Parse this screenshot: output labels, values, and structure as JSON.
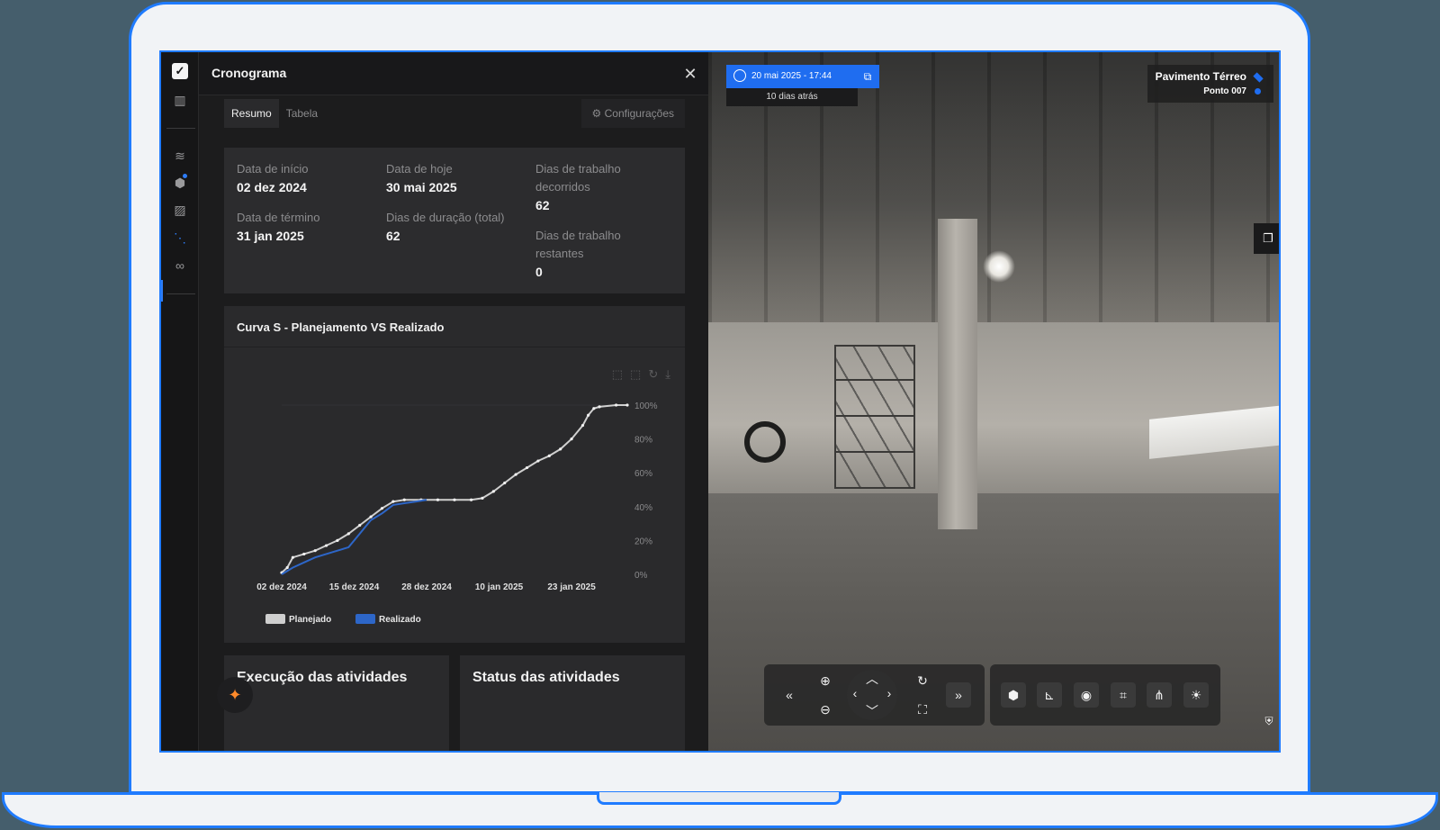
{
  "panel": {
    "title": "Cronograma",
    "close_icon": "close-icon",
    "tabs": [
      {
        "label": "Resumo",
        "active": true
      },
      {
        "label": "Tabela",
        "active": false
      }
    ],
    "config_label": "Configurações"
  },
  "summary": {
    "start_label": "Data de início",
    "start_value": "02 dez 2024",
    "today_label": "Data de hoje",
    "today_value": "30 mai 2025",
    "elapsed_label_1": "Dias de trabalho",
    "elapsed_label_2": "decorridos",
    "elapsed_value": "62",
    "end_label": "Data de término",
    "end_value": "31 jan 2025",
    "duration_label": "Dias de duração (total)",
    "duration_value": "62",
    "remaining_label_1": "Dias de trabalho",
    "remaining_label_2": "restantes",
    "remaining_value": "0"
  },
  "chart_card": {
    "title": "Curva S - Planejamento VS Realizado"
  },
  "chart_data": {
    "type": "line",
    "xlabel": "",
    "ylabel": "",
    "x_ticks": [
      "02 dez 2024",
      "15 dez 2024",
      "28 dez 2024",
      "10 jan 2025",
      "23 jan 2025"
    ],
    "y_ticks": [
      "0%",
      "20%",
      "40%",
      "60%",
      "80%",
      "100%"
    ],
    "ylim": [
      0,
      100
    ],
    "xlim": [
      0,
      62
    ],
    "series": [
      {
        "name": "Planejado",
        "color": "#cfcfcf",
        "points": [
          [
            0,
            1
          ],
          [
            1,
            4
          ],
          [
            2,
            10
          ],
          [
            4,
            12
          ],
          [
            6,
            14
          ],
          [
            8,
            17
          ],
          [
            10,
            20
          ],
          [
            12,
            24
          ],
          [
            14,
            29
          ],
          [
            16,
            34
          ],
          [
            18,
            39
          ],
          [
            20,
            43
          ],
          [
            22,
            44
          ],
          [
            25,
            44
          ],
          [
            28,
            44
          ],
          [
            31,
            44
          ],
          [
            34,
            44
          ],
          [
            36,
            45
          ],
          [
            38,
            49
          ],
          [
            40,
            54
          ],
          [
            42,
            59
          ],
          [
            44,
            63
          ],
          [
            46,
            67
          ],
          [
            48,
            70
          ],
          [
            50,
            74
          ],
          [
            52,
            80
          ],
          [
            54,
            88
          ],
          [
            55,
            94
          ],
          [
            56,
            98
          ],
          [
            57,
            99
          ],
          [
            60,
            100
          ],
          [
            62,
            100
          ]
        ]
      },
      {
        "name": "Realizado",
        "color": "#2d66c8",
        "points": [
          [
            0,
            0
          ],
          [
            2,
            4
          ],
          [
            4,
            7
          ],
          [
            6,
            10
          ],
          [
            8,
            12
          ],
          [
            10,
            14
          ],
          [
            12,
            16
          ],
          [
            14,
            24
          ],
          [
            16,
            32
          ],
          [
            18,
            36
          ],
          [
            20,
            41
          ],
          [
            22,
            42
          ],
          [
            24,
            43
          ],
          [
            26,
            44
          ]
        ]
      }
    ]
  },
  "bottom_cards": [
    {
      "title": "Execução das atividades"
    },
    {
      "title": "Status das atividades"
    }
  ],
  "viewer": {
    "date_label": "20 mai 2025 - 17:44",
    "date_sub": "10 dias atrás",
    "floor": "Pavimento Térreo",
    "point": "Ponto 007"
  },
  "icons": {
    "rail": [
      "app-logo-icon",
      "building-icon",
      "layers-icon",
      "tag-icon",
      "image-icon",
      "schedule-icon",
      "link-icon"
    ],
    "controls": [
      "first-icon",
      "zoom-in-icon",
      "zoom-out-icon",
      "dpad-icon",
      "rotate-icon",
      "fullscreen-icon",
      "last-icon",
      "tag-icon",
      "measure-icon",
      "capture-icon",
      "focus-icon",
      "share-icon",
      "brightness-icon"
    ]
  },
  "colors": {
    "accent": "#1f6df0",
    "planned": "#cfcfcf",
    "actual": "#2d66c8"
  }
}
